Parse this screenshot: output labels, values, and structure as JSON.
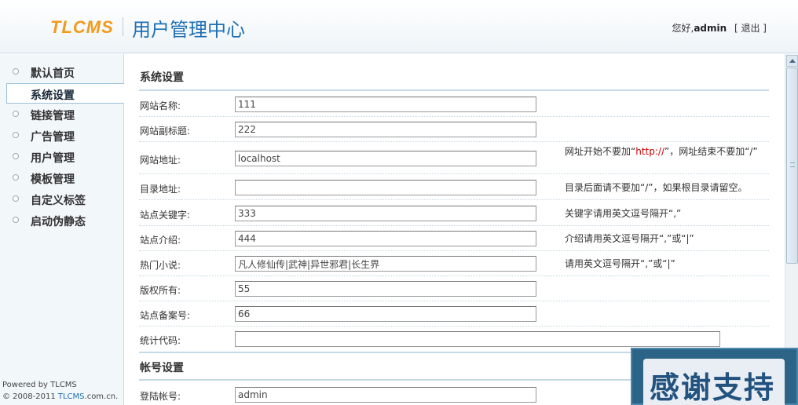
{
  "header": {
    "logo": "TLCMS",
    "title": "用户管理中心",
    "greeting": "您好,",
    "username": "admin",
    "logout": "[ 退出 ]"
  },
  "sidebar": {
    "items": [
      {
        "label": "默认首页"
      },
      {
        "label": "系统设置"
      },
      {
        "label": "链接管理"
      },
      {
        "label": "广告管理"
      },
      {
        "label": "用户管理"
      },
      {
        "label": "模板管理"
      },
      {
        "label": "自定义标签"
      },
      {
        "label": "启动伪静态"
      }
    ],
    "active_index": 1,
    "powered_line1": "Powered by TLCMS",
    "powered_prefix": "© 2008-2011 ",
    "powered_brand": "TLCMS",
    "powered_suffix": ".com.cn."
  },
  "system": {
    "title": "系统设置",
    "fields": [
      {
        "label": "网站名称:",
        "value": "111",
        "hint": ""
      },
      {
        "label": "网站副标题:",
        "value": "222",
        "hint": ""
      },
      {
        "label": "网站地址:",
        "value": "localhost",
        "hint_pre": "网址开始不要加“",
        "hint_red": "http://",
        "hint_post": "”，网址结束不要加“/”"
      },
      {
        "label": "目录地址:",
        "value": "",
        "hint": "目录后面请不要加“/”，如果根目录请留空。"
      },
      {
        "label": "站点关键字:",
        "value": "333",
        "hint": "关键字请用英文逗号隔开“,”"
      },
      {
        "label": "站点介绍:",
        "value": "444",
        "hint": "介绍请用英文逗号隔开“,”或“|”"
      },
      {
        "label": "热门小说:",
        "value": "凡人修仙传|武神|异世邪君|长生界",
        "hint": "请用英文逗号隔开“,”或“|”"
      },
      {
        "label": "版权所有:",
        "value": "55",
        "hint": ""
      },
      {
        "label": "站点备案号:",
        "value": "66",
        "hint": ""
      },
      {
        "label": "统计代码:",
        "value": "",
        "hint": ""
      }
    ]
  },
  "account": {
    "title": "帐号设置",
    "fields": [
      {
        "label": "登陆帐号:",
        "value": "admin"
      }
    ]
  },
  "thanks_banner": "感谢支持"
}
